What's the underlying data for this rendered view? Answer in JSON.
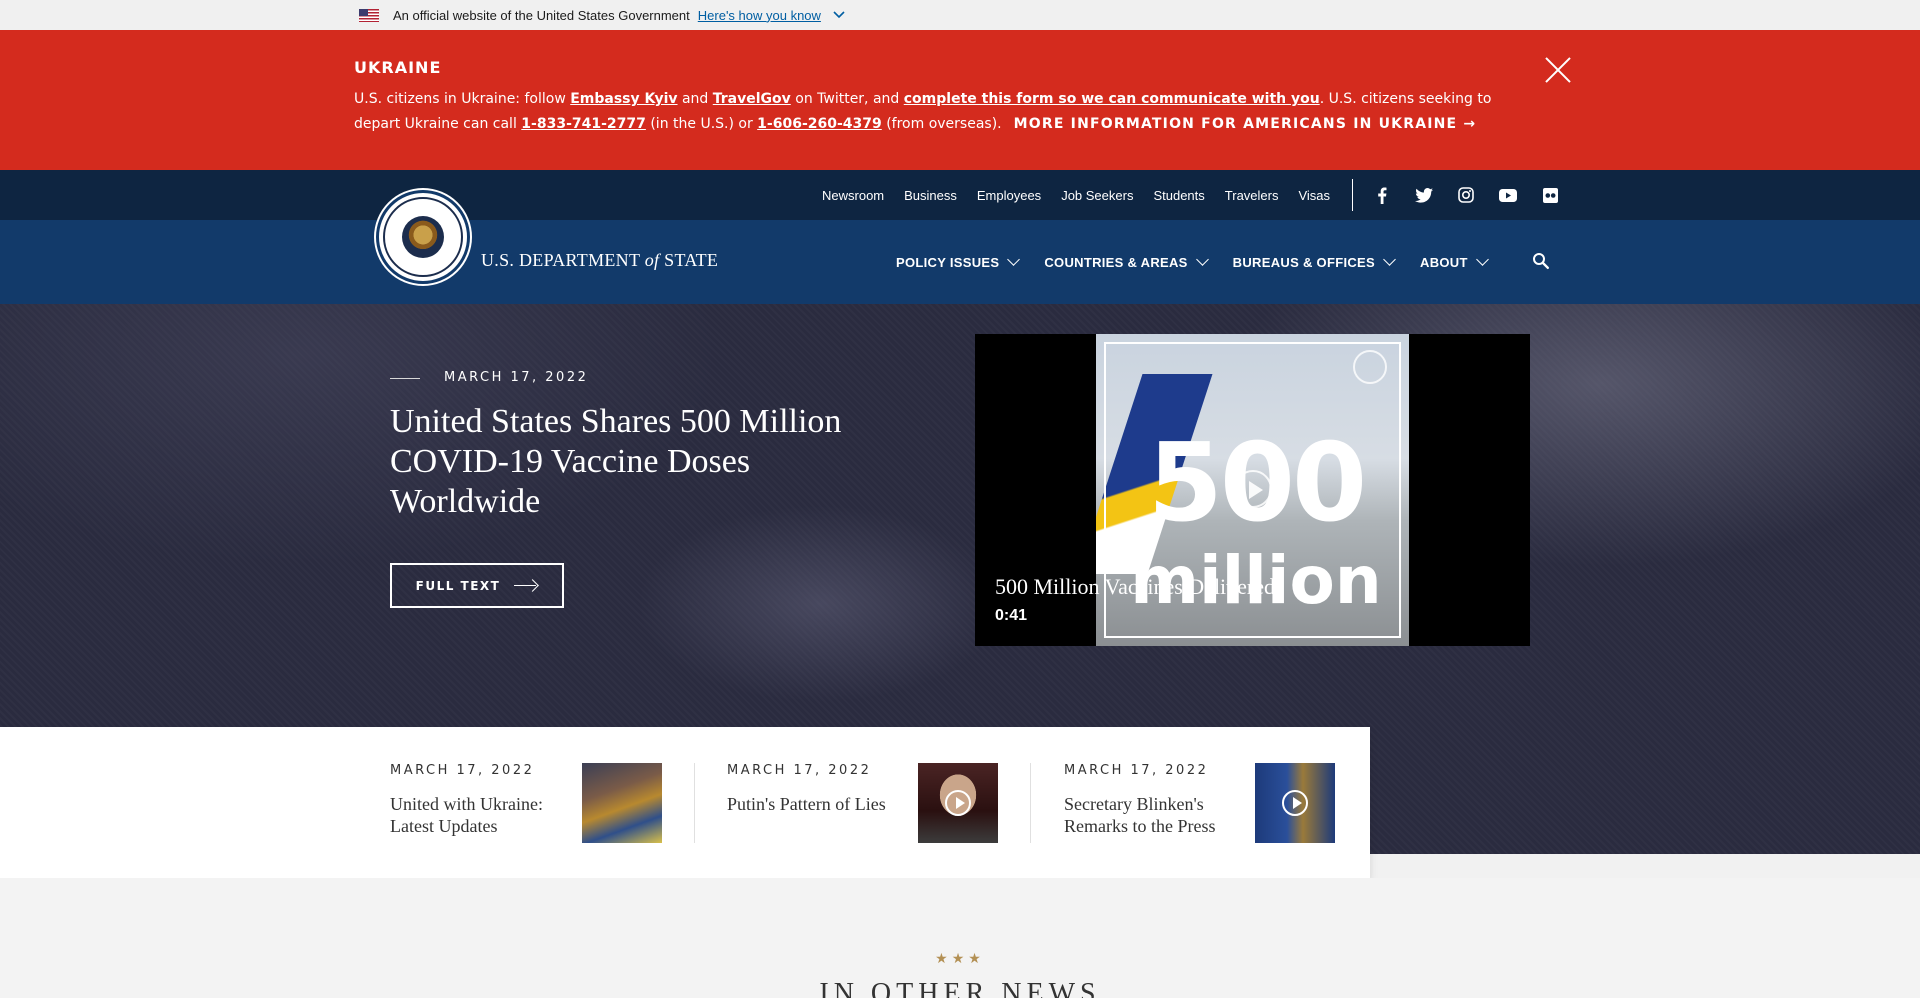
{
  "gov_banner": {
    "text": "An official website of the United States Government",
    "link": "Here's how you know"
  },
  "alert": {
    "title": "UKRAINE",
    "text_1": "U.S. citizens in Ukraine: follow ",
    "link_embassy": "Embassy Kyiv",
    "text_2": " and ",
    "link_travelgov": "TravelGov",
    "text_3": " on Twitter, and ",
    "link_form": "complete this form so we can communicate with you",
    "text_4": ". U.S. citizens seeking to depart Ukraine can call ",
    "phone_us": "1-833-741-2777",
    "text_5": " (in the U.S.) or ",
    "phone_overseas": "1-606-260-4379",
    "text_6": " (from overseas).",
    "more_link": "MORE INFORMATION FOR AMERICANS IN UKRAINE →"
  },
  "utility_nav": [
    "Newsroom",
    "Business",
    "Employees",
    "Job Seekers",
    "Students",
    "Travelers",
    "Visas"
  ],
  "social_icons": [
    "facebook-icon",
    "twitter-icon",
    "instagram-icon",
    "youtube-icon",
    "flickr-icon"
  ],
  "brand": {
    "name_prefix": "U.S. DEPARTMENT ",
    "name_of": "of",
    "name_suffix": " STATE"
  },
  "main_nav": [
    "POLICY ISSUES",
    "COUNTRIES & AREAS",
    "BUREAUS & OFFICES",
    "ABOUT"
  ],
  "hero": {
    "date": "MARCH 17, 2022",
    "headline": "United States Shares 500 Million COVID-19 Vaccine Doses Worldwide",
    "button": "FULL TEXT",
    "video": {
      "overlay_big": "500",
      "overlay_small": "million",
      "title": "500 Million Vaccines Delivered",
      "duration": "0:41"
    }
  },
  "featured": [
    {
      "date": "MARCH 17, 2022",
      "title": "United with Ukraine: Latest Updates"
    },
    {
      "date": "MARCH 17, 2022",
      "title": "Putin's Pattern of Lies"
    },
    {
      "date": "MARCH 17, 2022",
      "title": "Secretary Blinken's Remarks to the Press"
    }
  ],
  "other_news": {
    "stars": "★★★",
    "title": "IN OTHER NEWS"
  }
}
